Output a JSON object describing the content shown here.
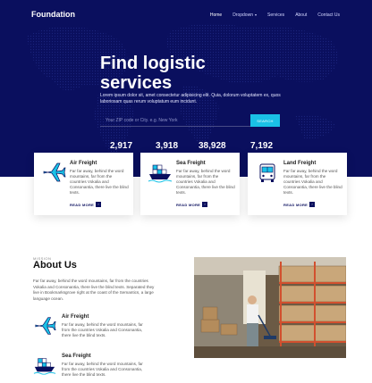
{
  "header": {
    "brand": "Foundation",
    "nav": [
      "Home",
      "Dropdown",
      "Services",
      "About",
      "Contact Us"
    ]
  },
  "hero": {
    "title_line1": "Find logistic",
    "title_line2": "services",
    "subtitle": "Lorem ipsum dolor sit, amet consectetur adipisicing elit. Quia, dolorum voluptatem ex, quos laboriosam quas rerum voluptatum eum incidunt.",
    "search_placeholder": "Your ZIP code or City. e.g. New York",
    "search_button": "SEARCH"
  },
  "stats": [
    "2,917",
    "3,918",
    "38,928",
    "7,192"
  ],
  "services": [
    {
      "title": "Air Freight",
      "text": "Far far away, behind the word mountains, far from the countries Vokalia and Consonantia, there live the blind texts.",
      "more": "READ MORE",
      "icon": "airplane-icon"
    },
    {
      "title": "Sea Freight",
      "text": "Far far away, behind the word mountains, far from the countries Vokalia and Consonantia, there live the blind texts.",
      "more": "READ MORE",
      "icon": "ship-icon"
    },
    {
      "title": "Land Freight",
      "text": "Far far away, behind the word mountains, far from the countries Vokalia and Consonantia, there live the blind texts.",
      "more": "READ MORE",
      "icon": "bus-icon"
    }
  ],
  "about": {
    "kicker": "MISSION",
    "title": "About Us",
    "text": "Far far away, behind the word mountains, far from the countries Vokalia and Consonantia, there live the blind texts. Separated they live in Bookmarksgrove right at the coast of the Semantics, a large language ocean.",
    "features": [
      {
        "title": "Air Freight",
        "text": "Far far away, behind the word mountains, far from the countries Vokalia and Consonantia, there live the blind texts.",
        "icon": "airplane-icon"
      },
      {
        "title": "Sea Freight",
        "text": "Far far away, behind the word mountains, far from the countries Vokalia and Consonantia, there live the blind texts.",
        "icon": "ship-icon"
      }
    ]
  },
  "colors": {
    "hero_bg": "#0a0f5e",
    "accent": "#1ac1e6"
  }
}
